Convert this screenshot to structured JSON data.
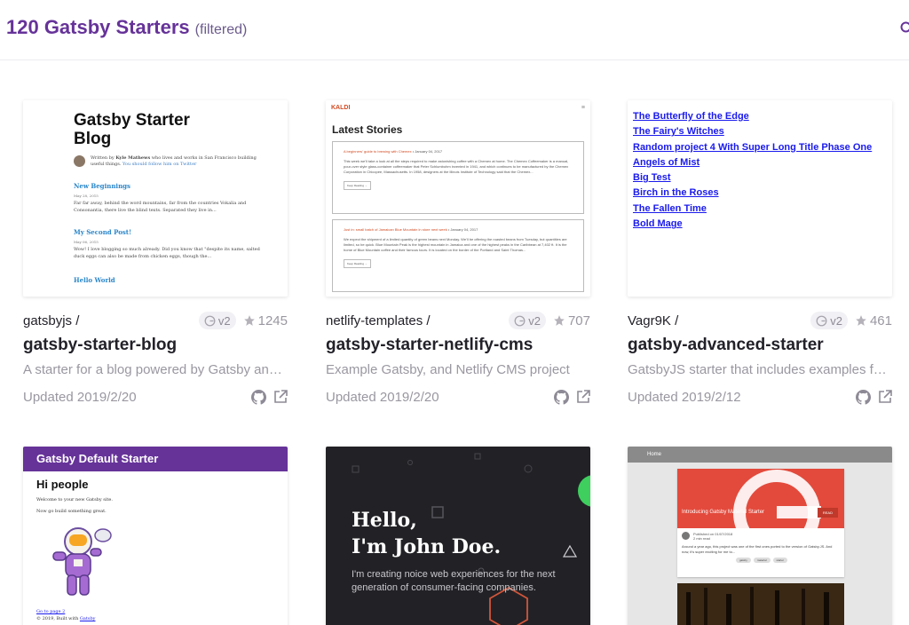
{
  "header": {
    "count_title": "120 Gatsby Starters",
    "filtered_label": "(filtered)"
  },
  "colors": {
    "brand": "#663399",
    "muted": "#9a97a1",
    "link_blue": "#1a1aee",
    "kaldi_accent": "#d24b22"
  },
  "icons": {
    "search": "search-icon",
    "github": "github-icon",
    "external": "external-link-icon",
    "star": "star-icon",
    "gatsby": "gatsby-logo-icon"
  },
  "cards": [
    {
      "owner": "gatsbyjs /",
      "version": "v2",
      "stars": "1245",
      "name": "gatsby-starter-blog",
      "description": "A starter for a blog powered by Gatsby and Markdown",
      "updated": "Updated 2019/2/20",
      "preview": {
        "title": "Gatsby Starter Blog",
        "bio_prefix": "Written by",
        "bio_author": "Kyle Mathews",
        "bio_suffix": "who lives and works in San Francisco building useful things.",
        "bio_link": "You should follow him on Twitter",
        "posts": [
          {
            "title": "New Beginnings",
            "date": "May 28, 2015",
            "body": "Far far away, behind the word mountains, far from the countries Vokalia and Consonantia, there live the blind texts. Separated they live in..."
          },
          {
            "title": "My Second Post!",
            "date": "May 06, 2015",
            "body": "Wow! I love blogging so much already. Did you know that \"despite its name, salted duck eggs can also be made from chicken eggs, though the..."
          },
          {
            "title": "Hello World",
            "date": "",
            "body": ""
          }
        ]
      }
    },
    {
      "owner": "netlify-templates /",
      "version": "v2",
      "stars": "707",
      "name": "gatsby-starter-netlify-cms",
      "description": "Example Gatsby, and Netlify CMS project",
      "updated": "Updated 2019/2/20",
      "preview": {
        "logo": "KALDI",
        "menu": "≡",
        "heading": "Latest Stories",
        "stories": [
          {
            "title": "A beginners' guide to brewing with Chemex",
            "date": "January 04, 2017",
            "body": "This week we'll take a look at all the steps required to make astonishing coffee with a Chemex at home. The Chemex Coffeemaker is a manual, pour-over style glass-container coffeemaker that Peter Schlumbohm invented in 1941, and which continues to be manufactured by the Chemex Corporation in Chicopee, Massachusetts. In 1958, designers at the Illinois Institute of Technology said that the Chemex...",
            "button": "Keep Reading →"
          },
          {
            "title": "Just in: small batch of Jamaican Blue Mountain in store next week",
            "date": "January 04, 2017",
            "body": "We expect the shipment of a limited quantity of green beans next Monday. We'll be offering the roasted beans from Tuesday, but quantities are limited, so be quick. Blue Mountain Peak is the highest mountain in Jamaica and one of the highest peaks in the Caribbean at 7,402 ft. It is the home of Blue Mountain coffee and their famous tours. It is located on the border of the Portland and Saint Thomas...",
            "button": "Keep Reading →"
          }
        ]
      }
    },
    {
      "owner": "Vagr9K /",
      "version": "v2",
      "stars": "461",
      "name": "gatsby-advanced-starter",
      "description": "GatsbyJS starter that includes examples for advanced use cases",
      "updated": "Updated 2019/2/12",
      "preview": {
        "links": [
          "The Butterfly of the Edge",
          "The Fairy's Witches",
          "Random project 4 With Super Long Title Phase One",
          "Angels of Mist",
          "Big Test",
          "Birch in the Roses",
          "The Fallen Time",
          "Bold Mage"
        ]
      }
    },
    {
      "preview": {
        "bar": "Gatsby Default Starter",
        "heading": "Hi people",
        "p1": "Welcome to your new Gatsby site.",
        "p2": "Now go build something great.",
        "link": "Go to page 2",
        "footer_prefix": "© 2019, Built with",
        "footer_link": "Gatsby"
      }
    },
    {
      "preview": {
        "heading_line1": "Hello,",
        "heading_line2": "I'm John Doe.",
        "body": "I'm creating noice web experiences for the next generation of consumer-facing companies."
      }
    },
    {
      "preview": {
        "bar": "Home",
        "hero_title": "Introducing Gatsby Material Starter",
        "read": "READ",
        "meta_line1": "Published on 01/07/2018",
        "meta_line2": "2 min read",
        "text": "Around a year ago, this project was one of the first ones ported to the version of Gatsby.JS. And now, it's super exciting for me to...",
        "tags": [
          "gatsby",
          "material",
          "starter"
        ]
      }
    }
  ]
}
